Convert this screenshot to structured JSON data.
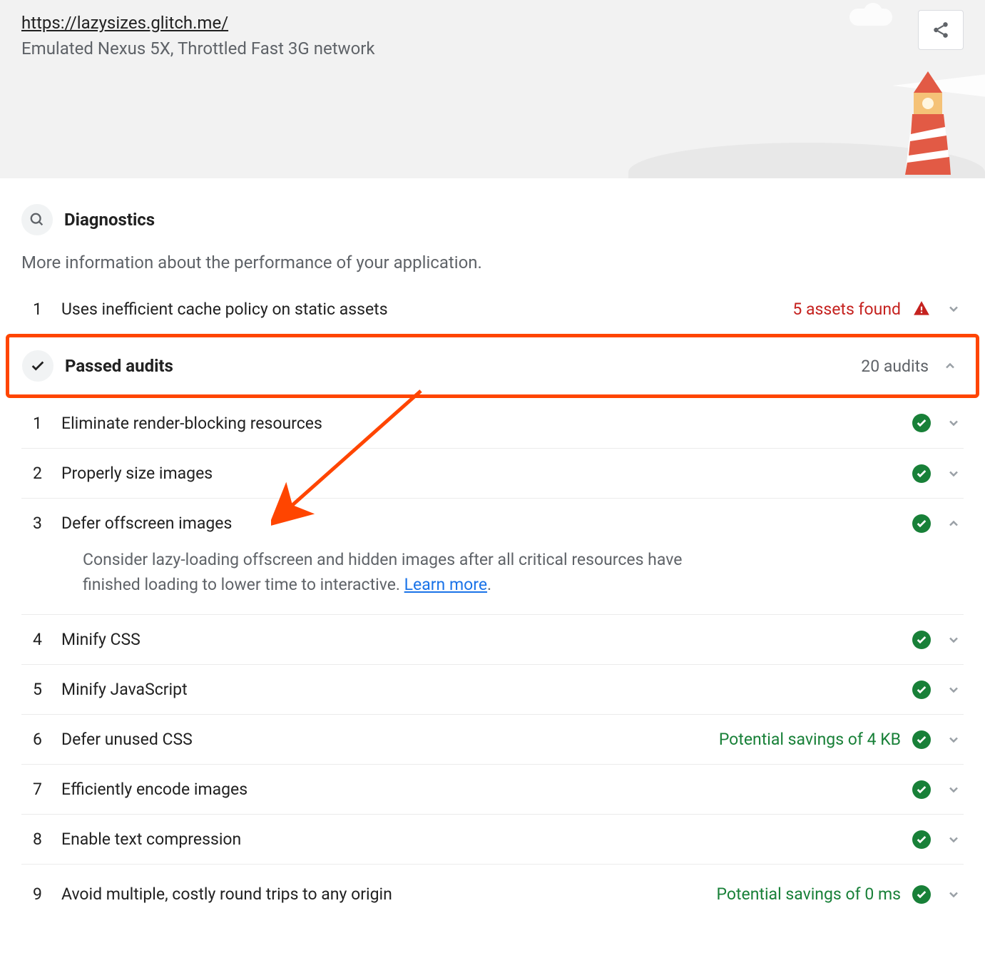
{
  "header": {
    "url": "https://lazysizes.glitch.me/",
    "emulation": "Emulated Nexus 5X, Throttled Fast 3G network"
  },
  "diagnostics": {
    "title": "Diagnostics",
    "description": "More information about the performance of your application.",
    "audits": [
      {
        "num": "1",
        "title": "Uses inefficient cache policy on static assets",
        "value": "5 assets found",
        "value_color": "red",
        "status": "warning",
        "expanded": false
      }
    ]
  },
  "passed": {
    "title": "Passed audits",
    "count": "20 audits",
    "audits": [
      {
        "num": "1",
        "title": "Eliminate render-blocking resources",
        "value": "",
        "status": "pass",
        "expanded": false
      },
      {
        "num": "2",
        "title": "Properly size images",
        "value": "",
        "status": "pass",
        "expanded": false
      },
      {
        "num": "3",
        "title": "Defer offscreen images",
        "value": "",
        "status": "pass",
        "expanded": true,
        "description": "Consider lazy-loading offscreen and hidden images after all critical resources have finished loading to lower time to interactive. ",
        "learn_more": "Learn more"
      },
      {
        "num": "4",
        "title": "Minify CSS",
        "value": "",
        "status": "pass",
        "expanded": false
      },
      {
        "num": "5",
        "title": "Minify JavaScript",
        "value": "",
        "status": "pass",
        "expanded": false
      },
      {
        "num": "6",
        "title": "Defer unused CSS",
        "value": "Potential savings of 4 KB",
        "value_color": "green",
        "status": "pass",
        "expanded": false
      },
      {
        "num": "7",
        "title": "Efficiently encode images",
        "value": "",
        "status": "pass",
        "expanded": false
      },
      {
        "num": "8",
        "title": "Enable text compression",
        "value": "",
        "status": "pass",
        "expanded": false
      },
      {
        "num": "9",
        "title": "Avoid multiple, costly round trips to any origin",
        "value": "Potential savings of 0 ms",
        "value_color": "green",
        "status": "pass",
        "expanded": false
      }
    ]
  }
}
